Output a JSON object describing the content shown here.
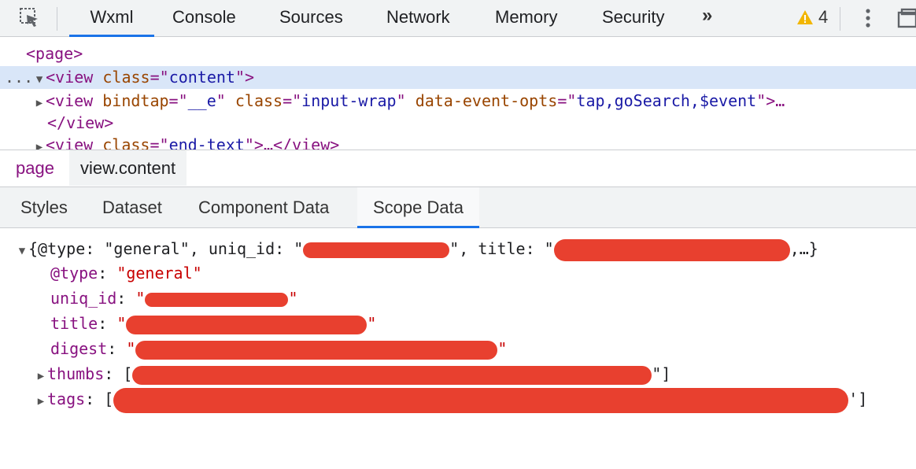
{
  "toolbar": {
    "tabs": [
      "Wxml",
      "Console",
      "Sources",
      "Network",
      "Memory",
      "Security"
    ],
    "active_tab": "Wxml",
    "more_tabs": "»",
    "warning_count": "4",
    "icons": [
      "inspect-icon",
      "warning-icon",
      "kebab-menu-icon",
      "dock-icon"
    ]
  },
  "tree": {
    "l1_tag": "<page>",
    "l2_prefix": "...",
    "l2_open": "<view ",
    "l2_attr": "class",
    "l2_eq": "=\"",
    "l2_val": "content",
    "l2_close": "\">",
    "l3_open": "<view ",
    "l3_a1": "bindtap",
    "l3_v1": "__e",
    "l3_a2": "class",
    "l3_v2": "input-wrap",
    "l3_a3": "data-event-opts",
    "l3_v3": "tap,goSearch,$event",
    "l3_close": "\">…",
    "l4_tag": "</view>",
    "l5_open": "<view ",
    "l5_attr": "class",
    "l5_val": "end-text",
    "l5_close": "\">…</view>"
  },
  "breadcrumb": {
    "items": [
      "page",
      "view.content"
    ]
  },
  "panel_tabs": {
    "tabs": [
      "Styles",
      "Dataset",
      "Component Data",
      "Scope Data"
    ],
    "active": "Scope Data"
  },
  "scope": {
    "summary_open": "{",
    "summary_k1": "@type",
    "summary_v1": "\"general\"",
    "summary_k2": "uniq_id",
    "summary_k3": "title",
    "summary_end": ",…}",
    "rows": [
      {
        "key": "@type",
        "value": "\"general\""
      },
      {
        "key": "uniq_id",
        "value": ""
      },
      {
        "key": "title",
        "value": ""
      },
      {
        "key": "digest",
        "value": ""
      },
      {
        "key": "thumbs",
        "value": ""
      },
      {
        "key": "tags",
        "value": ""
      }
    ]
  },
  "colors": {
    "accent": "#1a73e8",
    "tag": "#881280",
    "attr": "#994500",
    "attr_value": "#1a1aa6",
    "string": "#c80000",
    "redaction": "#e8402f",
    "selection": "#d9e6f8"
  }
}
